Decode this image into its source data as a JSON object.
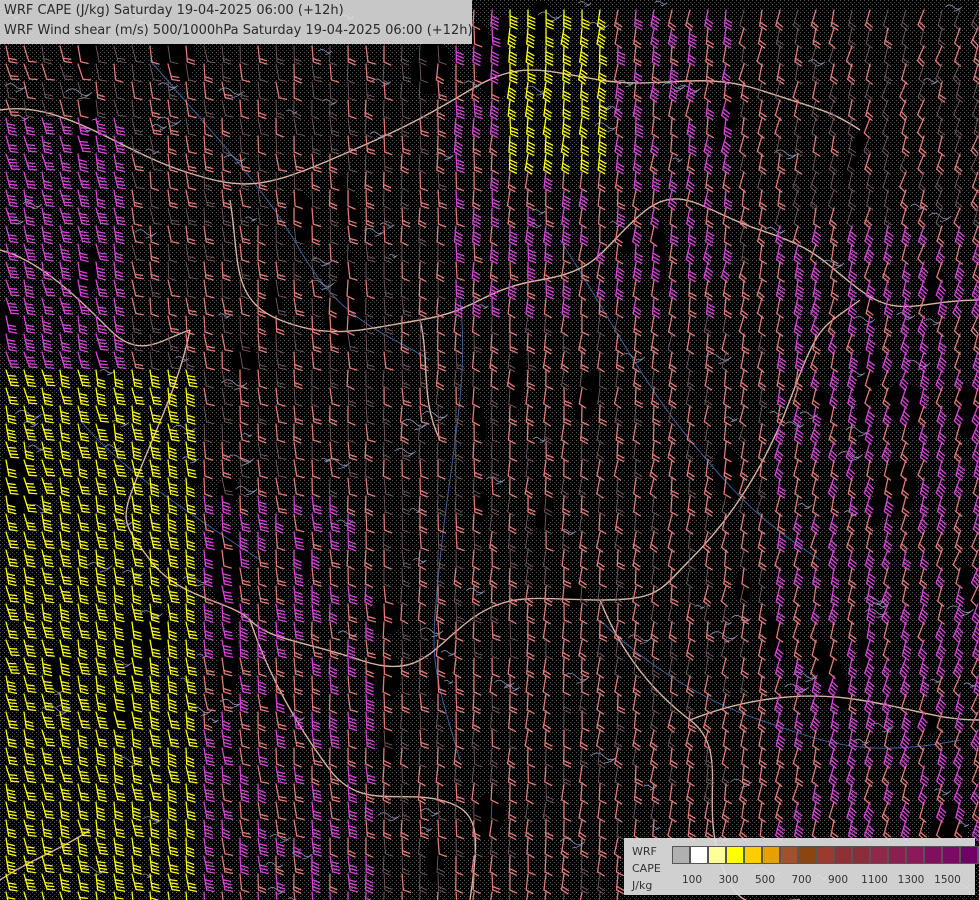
{
  "titles": {
    "line1": "WRF CAPE (J/kg) Saturday 19-04-2025 06:00 (+12h)",
    "line2": "WRF Wind shear (m/s) 500/1000hPa Saturday 19-04-2025 06:00 (+12h)"
  },
  "legend": {
    "label_model": "WRF",
    "label_field": "CAPE",
    "label_unit": "J/kg",
    "colors": [
      "#b0b0b0",
      "#ffffff",
      "#ffff99",
      "#ffff00",
      "#ffcc00",
      "#e6a000",
      "#a0522d",
      "#8b4513",
      "#9b3a2e",
      "#8e3038",
      "#8a2e3c",
      "#90284a",
      "#882050",
      "#8a1a5a",
      "#800f60",
      "#7a0a66",
      "#6e0068",
      "#800080"
    ],
    "ticks": [
      "100",
      "300",
      "500",
      "700",
      "900",
      "1100",
      "1300",
      "1500"
    ]
  },
  "map_colors": {
    "background": "#000000",
    "stipple": "#5a5a5a",
    "borders": "#d8b4a0",
    "rivers": "#3a5f9e",
    "contours": "#8a8fb0",
    "barbs_weak": "#7a5a5e",
    "barbs_moderate": "#e87878",
    "barbs_strong": "#e040e0",
    "barbs_extreme": "#ffff00"
  }
}
